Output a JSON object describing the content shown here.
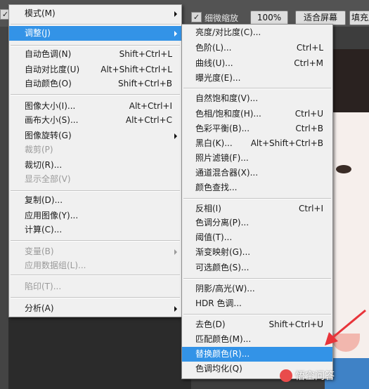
{
  "toolbar": {
    "checkbox_mark": "✓",
    "scrubby_zoom_label": "细微缩放",
    "zoom_100_label": "100%",
    "fit_screen_label": "适合屏幕",
    "fill_screen_label": "填充屏"
  },
  "image_menu": {
    "items": [
      {
        "label": "模式(M)",
        "shortcut": "",
        "submenu": true,
        "disabled": false,
        "highlighted": false
      },
      {
        "label": "调整(J)",
        "shortcut": "",
        "submenu": true,
        "disabled": false,
        "highlighted": true
      },
      {
        "label": "自动色调(N)",
        "shortcut": "Shift+Ctrl+L",
        "submenu": false,
        "disabled": false,
        "highlighted": false
      },
      {
        "label": "自动对比度(U)",
        "shortcut": "Alt+Shift+Ctrl+L",
        "submenu": false,
        "disabled": false,
        "highlighted": false
      },
      {
        "label": "自动颜色(O)",
        "shortcut": "Shift+Ctrl+B",
        "submenu": false,
        "disabled": false,
        "highlighted": false
      },
      {
        "label": "图像大小(I)...",
        "shortcut": "Alt+Ctrl+I",
        "submenu": false,
        "disabled": false,
        "highlighted": false
      },
      {
        "label": "画布大小(S)...",
        "shortcut": "Alt+Ctrl+C",
        "submenu": false,
        "disabled": false,
        "highlighted": false
      },
      {
        "label": "图像旋转(G)",
        "shortcut": "",
        "submenu": true,
        "disabled": false,
        "highlighted": false
      },
      {
        "label": "裁剪(P)",
        "shortcut": "",
        "submenu": false,
        "disabled": true,
        "highlighted": false
      },
      {
        "label": "裁切(R)...",
        "shortcut": "",
        "submenu": false,
        "disabled": false,
        "highlighted": false
      },
      {
        "label": "显示全部(V)",
        "shortcut": "",
        "submenu": false,
        "disabled": true,
        "highlighted": false
      },
      {
        "label": "复制(D)...",
        "shortcut": "",
        "submenu": false,
        "disabled": false,
        "highlighted": false
      },
      {
        "label": "应用图像(Y)...",
        "shortcut": "",
        "submenu": false,
        "disabled": false,
        "highlighted": false
      },
      {
        "label": "计算(C)...",
        "shortcut": "",
        "submenu": false,
        "disabled": false,
        "highlighted": false
      },
      {
        "label": "变量(B)",
        "shortcut": "",
        "submenu": true,
        "disabled": true,
        "highlighted": false
      },
      {
        "label": "应用数据组(L)...",
        "shortcut": "",
        "submenu": false,
        "disabled": true,
        "highlighted": false
      },
      {
        "label": "陷印(T)...",
        "shortcut": "",
        "submenu": false,
        "disabled": true,
        "highlighted": false
      },
      {
        "label": "分析(A)",
        "shortcut": "",
        "submenu": true,
        "disabled": false,
        "highlighted": false
      }
    ]
  },
  "adjust_submenu": {
    "items": [
      {
        "label": "亮度/对比度(C)...",
        "shortcut": "",
        "highlighted": false
      },
      {
        "label": "色阶(L)...",
        "shortcut": "Ctrl+L",
        "highlighted": false
      },
      {
        "label": "曲线(U)...",
        "shortcut": "Ctrl+M",
        "highlighted": false
      },
      {
        "label": "曝光度(E)...",
        "shortcut": "",
        "highlighted": false
      },
      {
        "label": "自然饱和度(V)...",
        "shortcut": "",
        "highlighted": false
      },
      {
        "label": "色相/饱和度(H)...",
        "shortcut": "Ctrl+U",
        "highlighted": false
      },
      {
        "label": "色彩平衡(B)...",
        "shortcut": "Ctrl+B",
        "highlighted": false
      },
      {
        "label": "黑白(K)...",
        "shortcut": "Alt+Shift+Ctrl+B",
        "highlighted": false
      },
      {
        "label": "照片滤镜(F)...",
        "shortcut": "",
        "highlighted": false
      },
      {
        "label": "通道混合器(X)...",
        "shortcut": "",
        "highlighted": false
      },
      {
        "label": "颜色查找...",
        "shortcut": "",
        "highlighted": false
      },
      {
        "label": "反相(I)",
        "shortcut": "Ctrl+I",
        "highlighted": false
      },
      {
        "label": "色调分离(P)...",
        "shortcut": "",
        "highlighted": false
      },
      {
        "label": "阈值(T)...",
        "shortcut": "",
        "highlighted": false
      },
      {
        "label": "渐变映射(G)...",
        "shortcut": "",
        "highlighted": false
      },
      {
        "label": "可选颜色(S)...",
        "shortcut": "",
        "highlighted": false
      },
      {
        "label": "阴影/高光(W)...",
        "shortcut": "",
        "highlighted": false
      },
      {
        "label": "HDR 色调...",
        "shortcut": "",
        "highlighted": false
      },
      {
        "label": "去色(D)",
        "shortcut": "Shift+Ctrl+U",
        "highlighted": false
      },
      {
        "label": "匹配颜色(M)...",
        "shortcut": "",
        "highlighted": false
      },
      {
        "label": "替换颜色(R)...",
        "shortcut": "",
        "highlighted": true
      },
      {
        "label": "色调均化(Q)",
        "shortcut": "",
        "highlighted": false
      }
    ]
  },
  "watermark": {
    "text": "悟空问答"
  },
  "colors": {
    "highlight": "#3393e7",
    "arrow": "#e8343a"
  }
}
